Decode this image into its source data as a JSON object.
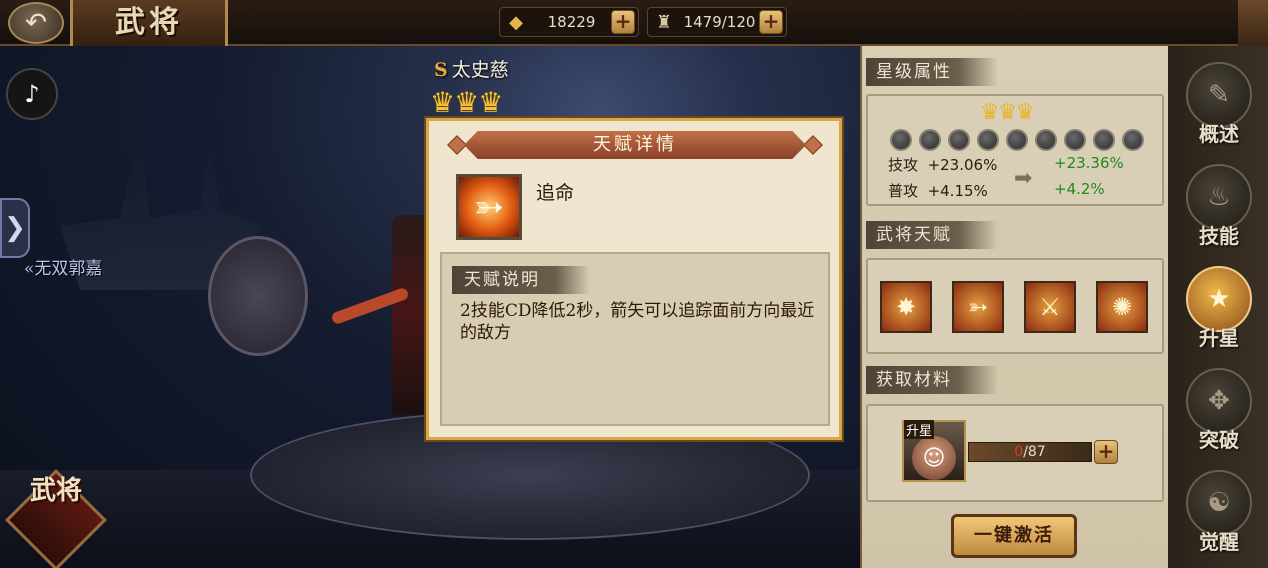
{
  "header": {
    "title": "武将",
    "gold": "18229",
    "stamina": "1479/120"
  },
  "scene": {
    "prev_hero": "无双郭嘉",
    "hero_grade": "S",
    "hero_name": "太史慈",
    "hero_stars": 3,
    "gate_badge": "武将"
  },
  "dialog": {
    "title": "天赋详情",
    "talent_name": "追命",
    "desc_header": "天赋说明",
    "desc_text": "2技能CD降低2秒，箭矢可以追踪面前方向最近的敌方"
  },
  "panel": {
    "star_attr_header": "星级属性",
    "star_crowns": 3,
    "star_dots": 9,
    "stats": [
      {
        "label": "技攻",
        "current": "+23.06%",
        "next": "+23.36%"
      },
      {
        "label": "普攻",
        "current": "+4.15%",
        "next": "+4.2%"
      }
    ],
    "talents_header": "武将天赋",
    "materials_header": "获取材料",
    "material_tag": "升星",
    "material_current": "0",
    "material_total": "/87",
    "activate_button": "一键激活"
  },
  "nav": [
    {
      "label": "概述",
      "icon": "book-quill-icon"
    },
    {
      "label": "技能",
      "icon": "flame-book-icon"
    },
    {
      "label": "升星",
      "icon": "star-icon"
    },
    {
      "label": "突破",
      "icon": "sword-icon"
    },
    {
      "label": "觉醒",
      "icon": "meditation-icon"
    }
  ]
}
